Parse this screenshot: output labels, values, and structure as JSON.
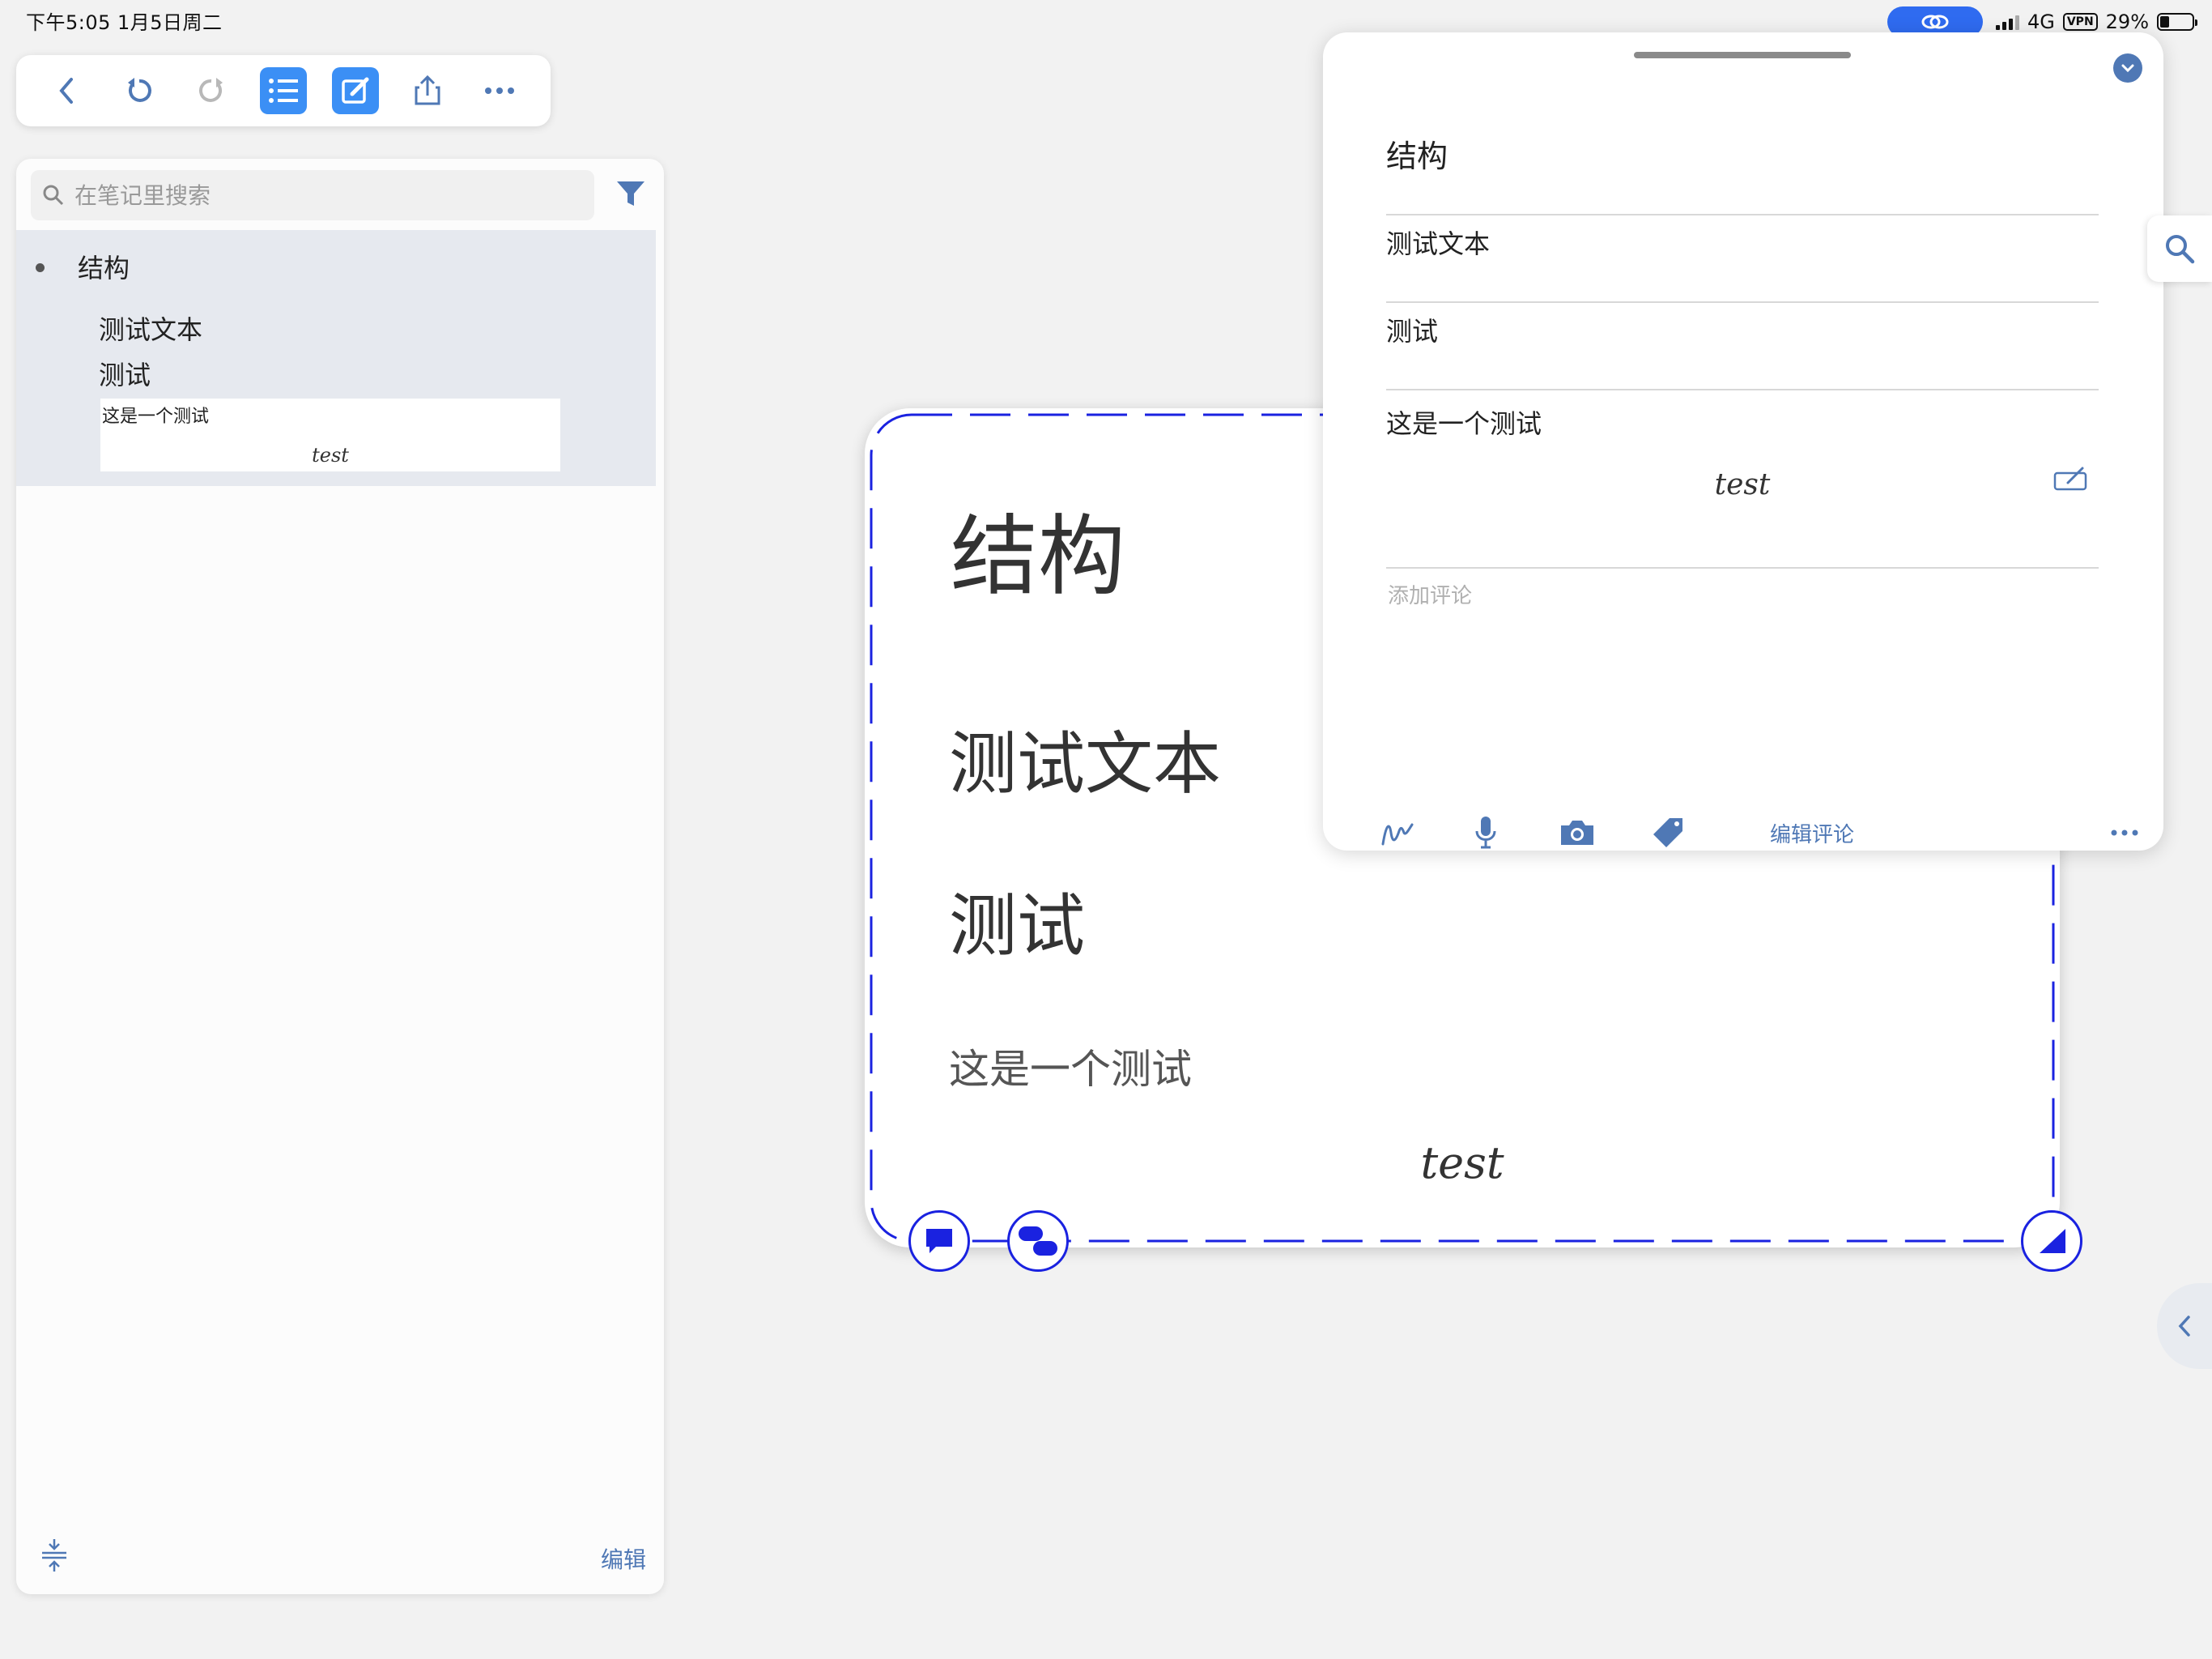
{
  "status_bar": {
    "time_date": "下午5:05   1月5日周二",
    "network": "4G",
    "vpn": "VPN",
    "battery": "29%"
  },
  "toolbar": {
    "buttons": [
      "back",
      "undo",
      "redo",
      "outline-list",
      "edit-note",
      "share",
      "more"
    ]
  },
  "outline": {
    "search_placeholder": "在笔记里搜索",
    "items": {
      "root": "结构",
      "child1": "测试文本",
      "child2": "测试",
      "card_text": "这是一个测试",
      "card_formula": "test"
    },
    "edit_label": "编辑"
  },
  "main_card": {
    "title": "结构",
    "line1": "测试文本",
    "line2": "测试",
    "note": "这是一个测试",
    "formula": "test"
  },
  "detail_sheet": {
    "title": "结构",
    "row1": "测试文本",
    "row2": "测试",
    "row3": "这是一个测试",
    "formula": "test",
    "comment_placeholder": "添加评论",
    "edit_comment_label": "编辑评论"
  },
  "colors": {
    "accent": "#3b8ff5",
    "icon_blue": "#4f78b5",
    "card_border": "#1a22e0",
    "status_pill": "#2f6bf0"
  }
}
